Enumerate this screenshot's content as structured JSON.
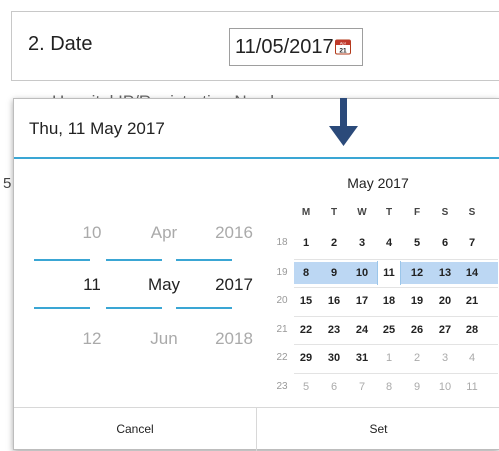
{
  "form": {
    "row_label": "2.  Date",
    "date_value": "11/05/2017",
    "calendar_icon_month": "Apr",
    "calendar_icon_day": "21",
    "behind_text": "Hospital IP/Registration Number",
    "behind_text_left": "5"
  },
  "dialog": {
    "header": "Thu, 11 May 2017",
    "spinners": {
      "day": {
        "prev": "10",
        "selected": "11",
        "next": "12"
      },
      "month": {
        "prev": "Apr",
        "selected": "May",
        "next": "Jun"
      },
      "year": {
        "prev": "2016",
        "selected": "2017",
        "next": "2018"
      }
    },
    "calendar": {
      "title": "May 2017",
      "weekdays": [
        "M",
        "T",
        "W",
        "T",
        "F",
        "S",
        "S"
      ],
      "weeks": [
        {
          "num": "18",
          "days": [
            "1",
            "2",
            "3",
            "4",
            "5",
            "6",
            "7"
          ]
        },
        {
          "num": "19",
          "days": [
            "8",
            "9",
            "10",
            "11",
            "12",
            "13",
            "14"
          ]
        },
        {
          "num": "20",
          "days": [
            "15",
            "16",
            "17",
            "18",
            "19",
            "20",
            "21"
          ]
        },
        {
          "num": "21",
          "days": [
            "22",
            "23",
            "24",
            "25",
            "26",
            "27",
            "28"
          ]
        },
        {
          "num": "22",
          "days": [
            "29",
            "30",
            "31",
            "1",
            "2",
            "3",
            "4"
          ]
        },
        {
          "num": "23",
          "days": [
            "5",
            "6",
            "7",
            "8",
            "9",
            "10",
            "11"
          ]
        }
      ]
    },
    "cancel_label": "Cancel",
    "set_label": "Set"
  },
  "colors": {
    "accent": "#3aa6d4",
    "selected_week": "#bcd7f3",
    "arrow": "#2b4a7a"
  }
}
